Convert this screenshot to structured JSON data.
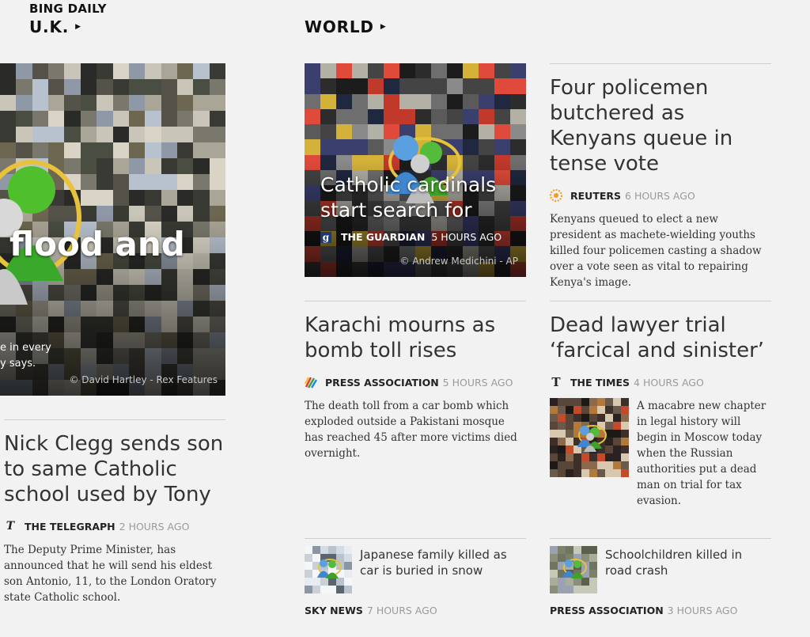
{
  "app": {
    "title": "BING DAILY"
  },
  "sections": {
    "uk": {
      "label": "U.K."
    },
    "world": {
      "label": "WORLD"
    }
  },
  "uk_hero": {
    "title": "flood and",
    "snippet_line1": "e in every",
    "snippet_line2": "y says.",
    "credit": "© David Hartley - Rex Features"
  },
  "world_hero": {
    "title_line1": "Catholic cardinals",
    "title_line2": "start search for",
    "source": "THE GUARDIAN",
    "time": "5 HOURS AGO",
    "credit": "© Andrew Medichini - AP"
  },
  "stories": {
    "kenya": {
      "headline": "Four policemen butchered as Kenyans queue in tense vote",
      "source": "REUTERS",
      "time": "6 HOURS AGO",
      "summary": "Kenyans queued to elect a new president as machete-wielding youths killed four policemen casting a shadow over a vote seen as vital to repairing Kenya's image."
    },
    "karachi": {
      "headline": "Karachi mourns as bomb toll rises",
      "source": "PRESS ASSOCIATION",
      "time": "5 HOURS AGO",
      "summary": "The death toll from a car bomb which exploded outside a Pakistani mosque has reached 45 after more victims died overnight."
    },
    "lawyer": {
      "headline": "Dead lawyer trial ‘farcical and sinister’",
      "source": "THE TIMES",
      "time": "4 HOURS AGO",
      "summary": "A macabre new chapter in legal history will begin in Moscow today when the Russian authorities put a dead man on trial for tax evasion."
    },
    "clegg": {
      "headline": "Nick Clegg sends son to same Catholic school used by Tony",
      "source": "THE TELEGRAPH",
      "time": "2 HOURS AGO",
      "summary": "The Deputy Prime Minister, has announced that he will send his eldest son Antonio, 11, to the London Oratory state Catholic school."
    },
    "japan": {
      "headline": "Japanese family killed as car is buried in snow",
      "source": "SKY NEWS",
      "time": "7 HOURS AGO"
    },
    "school": {
      "headline": "Schoolchildren killed in road crash",
      "source": "PRESS ASSOCIATION",
      "time": "3 HOURS AGO"
    }
  },
  "colors": {
    "background": "#f2f2f2",
    "divider": "#cfcfcf",
    "time_gray": "#9a9a9a"
  },
  "icons": {
    "section_arrow": "triangle-right-icon",
    "guardian": "guardian-logo-icon",
    "reuters": "reuters-logo-icon",
    "press_association": "press-association-logo-icon",
    "times": "times-logo-icon",
    "telegraph": "telegraph-logo-icon"
  }
}
